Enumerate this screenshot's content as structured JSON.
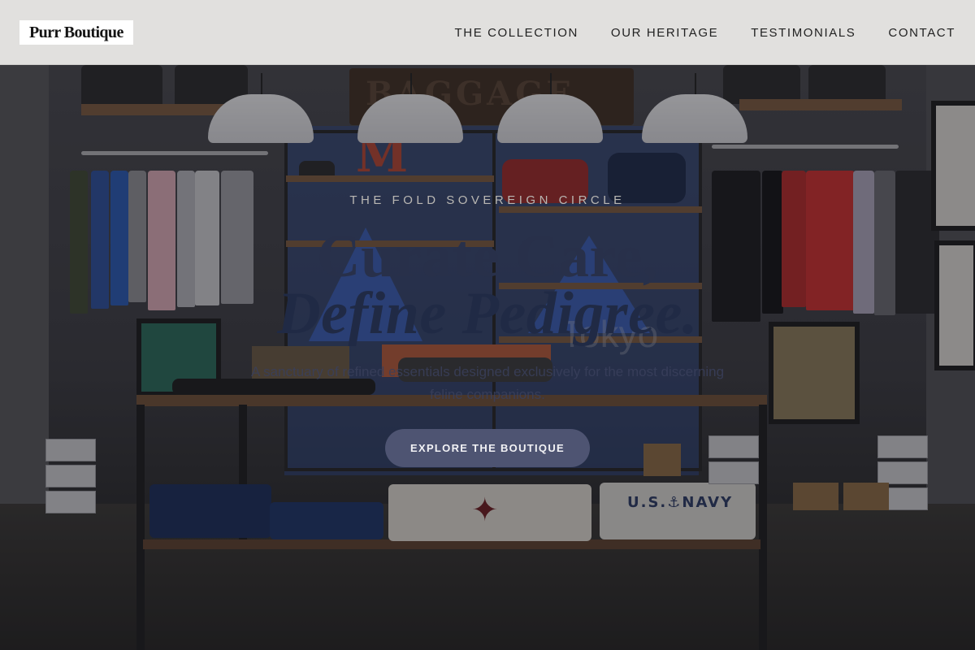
{
  "header": {
    "logo_text": "Purr Boutique",
    "nav": [
      {
        "label": "THE COLLECTION"
      },
      {
        "label": "OUR HERITAGE"
      },
      {
        "label": "TESTIMONIALS"
      },
      {
        "label": "CONTACT"
      }
    ]
  },
  "hero": {
    "eyebrow": "THE FOLD SOVEREIGN CIRCLE",
    "headline_line1": "Curate Care,",
    "headline_line2": "Define Pedigree.",
    "subtitle": "A sanctuary of refined essentials designed exclusively for the most discerning feline companions.",
    "cta_label": "EXPLORE THE BOUTIQUE",
    "background_sign_text": "BAGGAGE",
    "background_tokyo_text": "Tokyo",
    "background_navy_text": "U.S.⚓NAVY"
  },
  "colors": {
    "header_bg": "#e8e7e5",
    "cta_bg": "#4e5472",
    "headline": "#28304a"
  }
}
